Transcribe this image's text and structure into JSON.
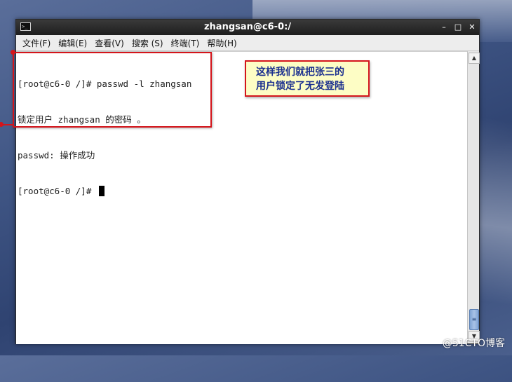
{
  "window": {
    "title": "zhangsan@c6-0:/",
    "icon": "terminal-icon",
    "controls": [
      "–",
      "□",
      "✕"
    ]
  },
  "menu": [
    {
      "label": "文件(F)"
    },
    {
      "label": "编辑(E)"
    },
    {
      "label": "查看(V)"
    },
    {
      "label": "搜索 (S)"
    },
    {
      "label": "终端(T)"
    },
    {
      "label": "帮助(H)"
    }
  ],
  "terminal": {
    "lines": [
      "[root@c6-0 /]# passwd -l zhangsan",
      "锁定用户 zhangsan 的密码 。",
      "passwd: 操作成功",
      "[root@c6-0 /]# "
    ]
  },
  "annotation": {
    "callout_line1": "这样我们就把张三的",
    "callout_line2": "用户锁定了无发登陆",
    "highlight_color": "#d4151b",
    "callout_bg": "#fdfdc5"
  },
  "watermark": "@51CTO博客"
}
